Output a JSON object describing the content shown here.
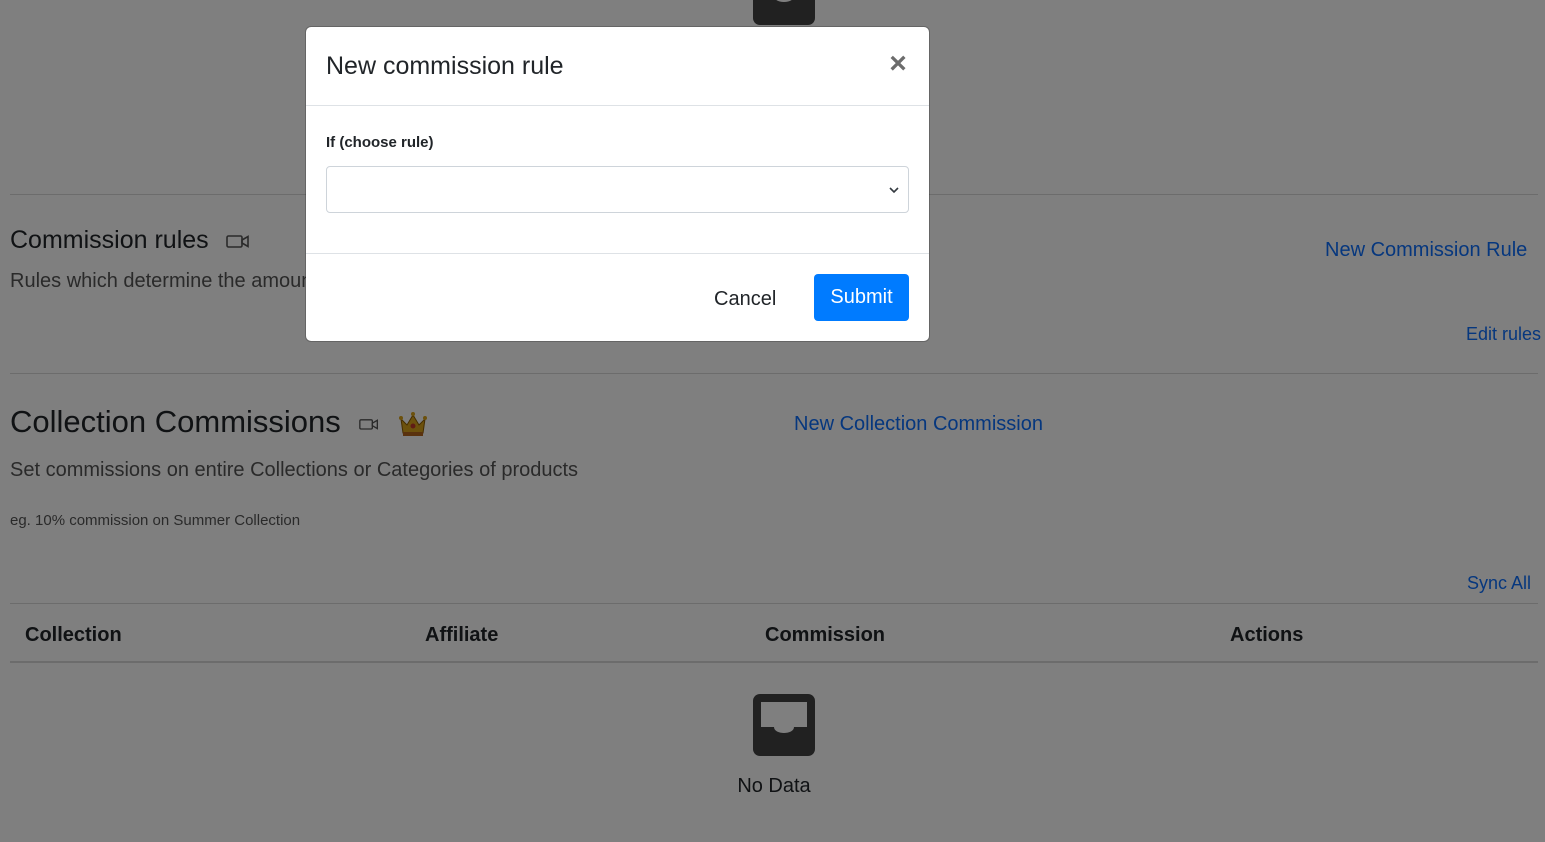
{
  "commission_rules": {
    "title": "Commission rules",
    "description": "Rules which determine the amount",
    "new_link": "New Commission Rule",
    "edit_link": "Edit rules"
  },
  "collection_commissions": {
    "title": "Collection Commissions",
    "description": "Set commissions on entire Collections or Categories of products",
    "example": "eg. 10% commission on Summer Collection",
    "new_link": "New Collection Commission",
    "sync_link": "Sync All",
    "columns": [
      "Collection",
      "Affiliate",
      "Commission",
      "Actions"
    ],
    "empty_text": "No Data"
  },
  "modal": {
    "title": "New commission rule",
    "close_symbol": "×",
    "field_label": "If (choose rule)",
    "select_value": "",
    "cancel_label": "Cancel",
    "submit_label": "Submit"
  },
  "icons": {
    "empty": "inbox-icon",
    "video": "video-camera-icon",
    "premium": "crown-icon",
    "close": "close-icon",
    "dropdown": "chevron-down-icon"
  },
  "colors": {
    "link": "#0d6efd",
    "primary_button": "#007bff",
    "backdrop": "rgba(0,0,0,0.5)"
  }
}
